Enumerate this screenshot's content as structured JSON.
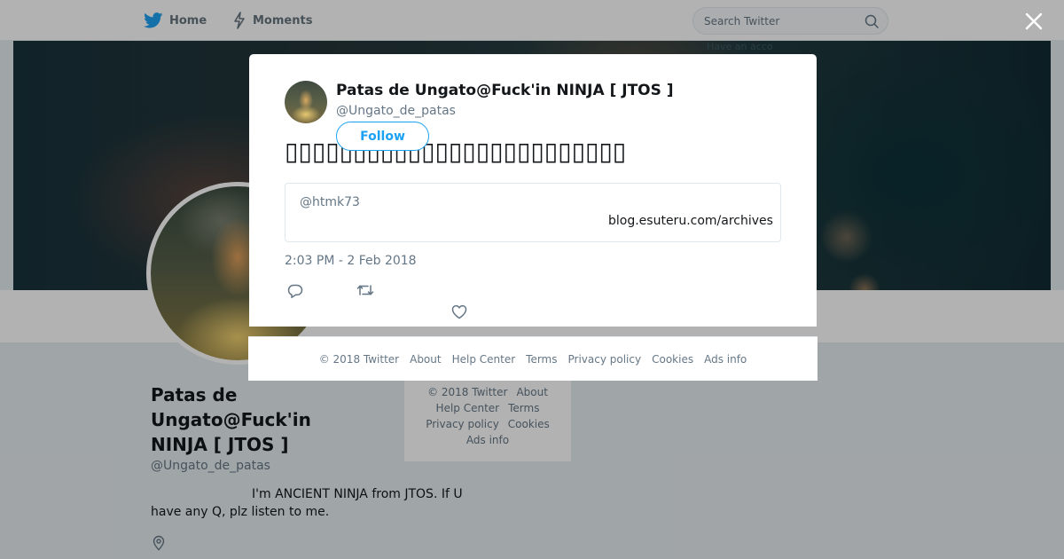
{
  "topnav": {
    "home_label": "Home",
    "moments_label": "Moments",
    "search_placeholder": "Search Twitter"
  },
  "banner": {
    "behind_text": "Have an acco"
  },
  "profile": {
    "name": "Patas de Ungato@Fuck'in NINJA [ JTOS ]",
    "handle": "@Ungato_de_patas",
    "bio": "I'm ANCIENT NINJA from JTOS. If U have any Q, plz listen to me."
  },
  "side_footer": {
    "copyright": "© 2018 Twitter",
    "about": "About",
    "help": "Help Center",
    "terms": "Terms",
    "privacy": "Privacy policy",
    "cookies": "Cookies",
    "ads": "Ads info"
  },
  "tweet": {
    "author_name": "Patas de Ungato@Fuck'in NINJA [ JTOS ]",
    "author_handle": "@Ungato_de_patas",
    "follow_label": "Follow",
    "text": "▯▯▯▯▯▯▯▯▯▯▯▯▯▯▯▯▯▯▯▯▯▯▯▯▯",
    "quote_handle": "@htmk73",
    "quote_link": "blog.esuteru.com/archives",
    "timestamp": "2:03 PM - 2 Feb 2018",
    "icons": {
      "reply": "reply-icon",
      "retweet": "retweet-icon",
      "like": "heart-icon"
    }
  },
  "modal_footer": {
    "copyright": "© 2018 Twitter",
    "about": "About",
    "help": "Help Center",
    "terms": "Terms",
    "privacy": "Privacy policy",
    "cookies": "Cookies",
    "ads": "Ads info"
  },
  "colors": {
    "accent": "#1da1f2",
    "secondary_text": "#657786",
    "page_background": "#e6ecf0"
  }
}
